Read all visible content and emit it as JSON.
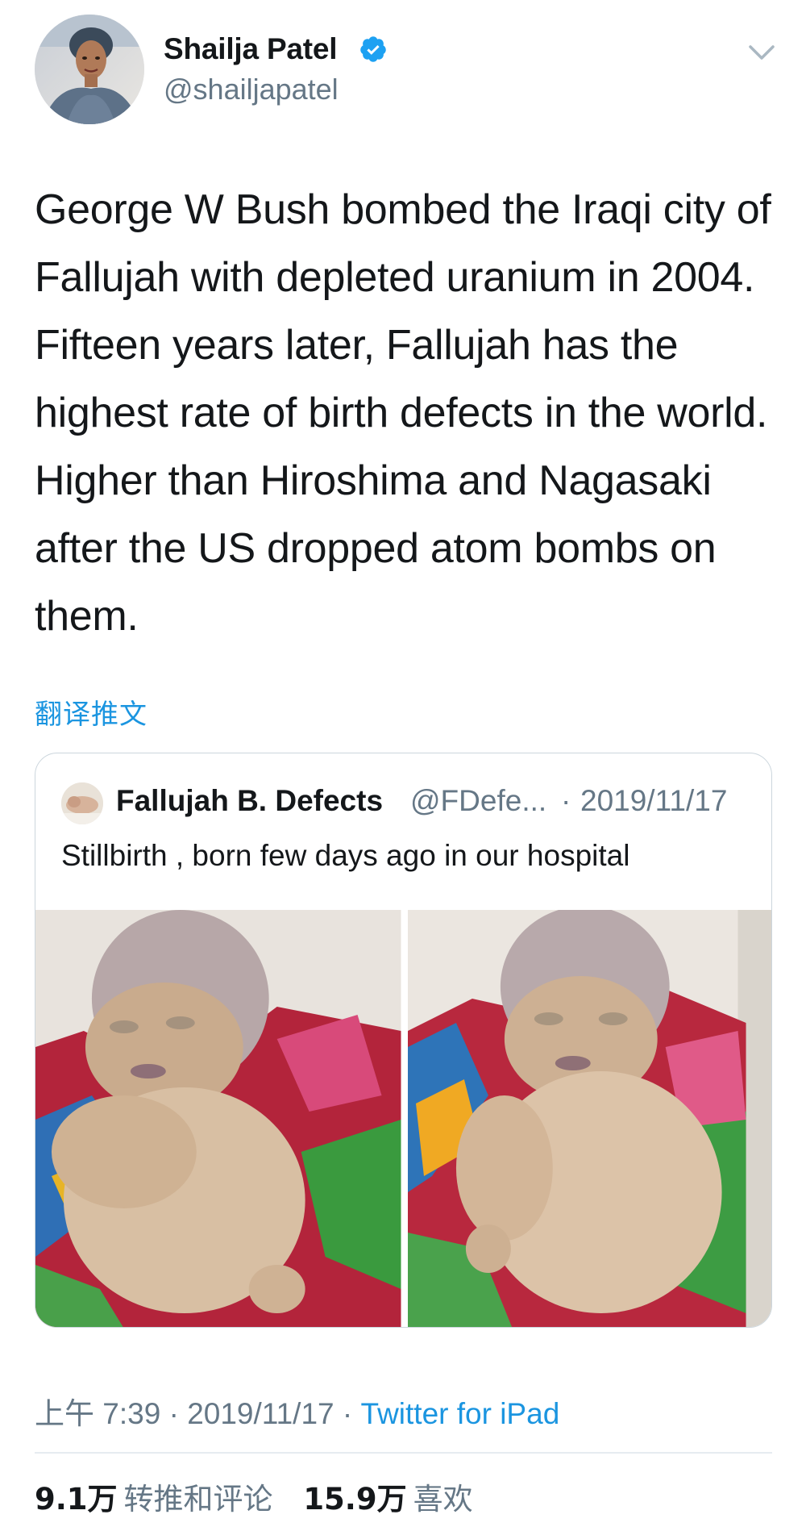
{
  "author": {
    "display_name": "Shailja Patel",
    "handle": "@shailjapatel",
    "verified": true
  },
  "tweet": {
    "text": "George W Bush bombed the Iraqi city of Fallujah with depleted uranium in 2004. Fifteen years later, Fallujah has the highest rate of birth defects in the world. Higher than Hiroshima and Nagasaki after the US dropped atom bombs on them.",
    "translate_label": "翻译推文"
  },
  "quoted_tweet": {
    "display_name": "Fallujah B. Defects",
    "handle": "@FDefe...",
    "separator": "·",
    "date": "2019/11/17",
    "text": "Stillbirth , born few days ago in our hospital",
    "media_count": 2
  },
  "meta": {
    "time": "上午 7:39",
    "sep1": "·",
    "date": "2019/11/17",
    "sep2": "·",
    "client": "Twitter for iPad"
  },
  "stats": {
    "retweets_count": "9.1万",
    "retweets_label": "转推和评论",
    "likes_count": "15.9万",
    "likes_label": "喜欢"
  },
  "icons": {
    "verified": "verified-badge-icon",
    "more": "chevron-down-icon"
  },
  "colors": {
    "text_primary": "#14171a",
    "text_secondary": "#657786",
    "link": "#1b95e0",
    "verified": "#1da1f2",
    "border": "#ccd6dd"
  }
}
